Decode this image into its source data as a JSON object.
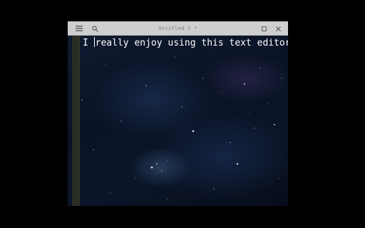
{
  "window": {
    "title": "Untitled 1 *",
    "menu_icon": "hamburger-menu-icon",
    "search_icon": "search-icon",
    "maximize_icon": "maximize-icon",
    "close_icon": "close-icon"
  },
  "editor": {
    "text_before_cursor": "I ",
    "text_after_cursor": "really enjoy using this text editor",
    "font_color": "#ffffff",
    "gutter_color": "#2a2d24"
  }
}
